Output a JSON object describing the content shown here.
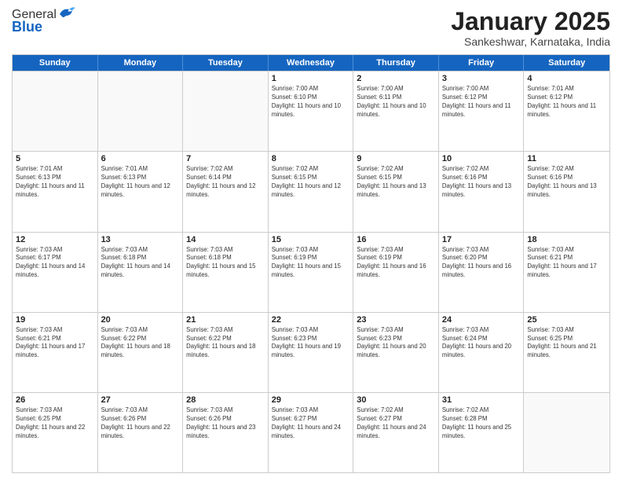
{
  "logo": {
    "general": "General",
    "blue": "Blue"
  },
  "header": {
    "month": "January 2025",
    "location": "Sankeshwar, Karnataka, India"
  },
  "weekdays": [
    "Sunday",
    "Monday",
    "Tuesday",
    "Wednesday",
    "Thursday",
    "Friday",
    "Saturday"
  ],
  "rows": [
    [
      {
        "day": "",
        "empty": true
      },
      {
        "day": "",
        "empty": true
      },
      {
        "day": "",
        "empty": true
      },
      {
        "day": "1",
        "sunrise": "7:00 AM",
        "sunset": "6:10 PM",
        "daylight": "11 hours and 10 minutes."
      },
      {
        "day": "2",
        "sunrise": "7:00 AM",
        "sunset": "6:11 PM",
        "daylight": "11 hours and 10 minutes."
      },
      {
        "day": "3",
        "sunrise": "7:00 AM",
        "sunset": "6:12 PM",
        "daylight": "11 hours and 11 minutes."
      },
      {
        "day": "4",
        "sunrise": "7:01 AM",
        "sunset": "6:12 PM",
        "daylight": "11 hours and 11 minutes."
      }
    ],
    [
      {
        "day": "5",
        "sunrise": "7:01 AM",
        "sunset": "6:13 PM",
        "daylight": "11 hours and 11 minutes."
      },
      {
        "day": "6",
        "sunrise": "7:01 AM",
        "sunset": "6:13 PM",
        "daylight": "11 hours and 12 minutes."
      },
      {
        "day": "7",
        "sunrise": "7:02 AM",
        "sunset": "6:14 PM",
        "daylight": "11 hours and 12 minutes."
      },
      {
        "day": "8",
        "sunrise": "7:02 AM",
        "sunset": "6:15 PM",
        "daylight": "11 hours and 12 minutes."
      },
      {
        "day": "9",
        "sunrise": "7:02 AM",
        "sunset": "6:15 PM",
        "daylight": "11 hours and 13 minutes."
      },
      {
        "day": "10",
        "sunrise": "7:02 AM",
        "sunset": "6:16 PM",
        "daylight": "11 hours and 13 minutes."
      },
      {
        "day": "11",
        "sunrise": "7:02 AM",
        "sunset": "6:16 PM",
        "daylight": "11 hours and 13 minutes."
      }
    ],
    [
      {
        "day": "12",
        "sunrise": "7:03 AM",
        "sunset": "6:17 PM",
        "daylight": "11 hours and 14 minutes."
      },
      {
        "day": "13",
        "sunrise": "7:03 AM",
        "sunset": "6:18 PM",
        "daylight": "11 hours and 14 minutes."
      },
      {
        "day": "14",
        "sunrise": "7:03 AM",
        "sunset": "6:18 PM",
        "daylight": "11 hours and 15 minutes."
      },
      {
        "day": "15",
        "sunrise": "7:03 AM",
        "sunset": "6:19 PM",
        "daylight": "11 hours and 15 minutes."
      },
      {
        "day": "16",
        "sunrise": "7:03 AM",
        "sunset": "6:19 PM",
        "daylight": "11 hours and 16 minutes."
      },
      {
        "day": "17",
        "sunrise": "7:03 AM",
        "sunset": "6:20 PM",
        "daylight": "11 hours and 16 minutes."
      },
      {
        "day": "18",
        "sunrise": "7:03 AM",
        "sunset": "6:21 PM",
        "daylight": "11 hours and 17 minutes."
      }
    ],
    [
      {
        "day": "19",
        "sunrise": "7:03 AM",
        "sunset": "6:21 PM",
        "daylight": "11 hours and 17 minutes."
      },
      {
        "day": "20",
        "sunrise": "7:03 AM",
        "sunset": "6:22 PM",
        "daylight": "11 hours and 18 minutes."
      },
      {
        "day": "21",
        "sunrise": "7:03 AM",
        "sunset": "6:22 PM",
        "daylight": "11 hours and 18 minutes."
      },
      {
        "day": "22",
        "sunrise": "7:03 AM",
        "sunset": "6:23 PM",
        "daylight": "11 hours and 19 minutes."
      },
      {
        "day": "23",
        "sunrise": "7:03 AM",
        "sunset": "6:23 PM",
        "daylight": "11 hours and 20 minutes."
      },
      {
        "day": "24",
        "sunrise": "7:03 AM",
        "sunset": "6:24 PM",
        "daylight": "11 hours and 20 minutes."
      },
      {
        "day": "25",
        "sunrise": "7:03 AM",
        "sunset": "6:25 PM",
        "daylight": "11 hours and 21 minutes."
      }
    ],
    [
      {
        "day": "26",
        "sunrise": "7:03 AM",
        "sunset": "6:25 PM",
        "daylight": "11 hours and 22 minutes."
      },
      {
        "day": "27",
        "sunrise": "7:03 AM",
        "sunset": "6:26 PM",
        "daylight": "11 hours and 22 minutes."
      },
      {
        "day": "28",
        "sunrise": "7:03 AM",
        "sunset": "6:26 PM",
        "daylight": "11 hours and 23 minutes."
      },
      {
        "day": "29",
        "sunrise": "7:03 AM",
        "sunset": "6:27 PM",
        "daylight": "11 hours and 24 minutes."
      },
      {
        "day": "30",
        "sunrise": "7:02 AM",
        "sunset": "6:27 PM",
        "daylight": "11 hours and 24 minutes."
      },
      {
        "day": "31",
        "sunrise": "7:02 AM",
        "sunset": "6:28 PM",
        "daylight": "11 hours and 25 minutes."
      },
      {
        "day": "",
        "empty": true
      }
    ]
  ]
}
